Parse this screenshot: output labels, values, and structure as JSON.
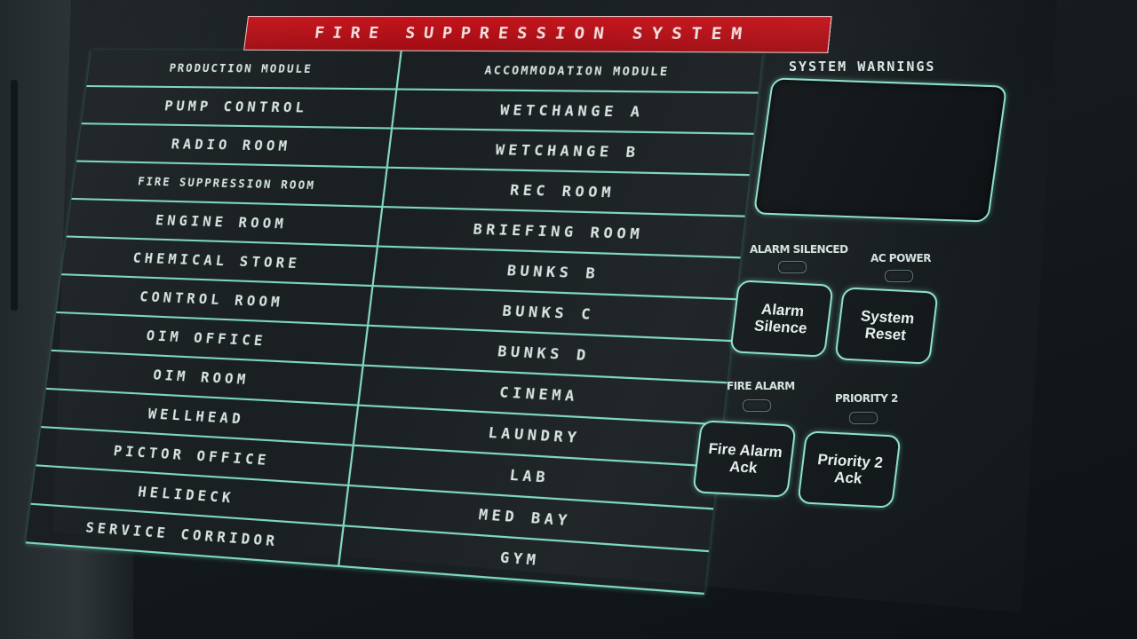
{
  "panel": {
    "title": "FIRE SUPPRESSION SYSTEM",
    "left_header": "PRODUCTION MODULE",
    "right_header": "ACCOMMODATION MODULE",
    "left_zones": [
      "PUMP CONTROL",
      "RADIO ROOM",
      "FIRE SUPPRESSION ROOM",
      "ENGINE ROOM",
      "CHEMICAL STORE",
      "CONTROL ROOM",
      "OIM OFFICE",
      "OIM ROOM",
      "WELLHEAD",
      "PICTOR OFFICE",
      "HELIDECK",
      "SERVICE CORRIDOR",
      ""
    ],
    "right_zones": [
      "WETCHANGE A",
      "WETCHANGE B",
      "REC ROOM",
      "BRIEFING ROOM",
      "BUNKS B",
      "BUNKS C",
      "BUNKS D",
      "CINEMA",
      "LAUNDRY",
      "LAB",
      "MED BAY",
      "GYM"
    ]
  },
  "warnings": {
    "title": "SYSTEM WARNINGS"
  },
  "indicators": {
    "alarm_silenced": "ALARM SILENCED",
    "ac_power": "AC POWER",
    "fire_alarm": "FIRE ALARM",
    "priority_2": "PRIORITY 2"
  },
  "buttons": {
    "alarm_silence": "Alarm\nSilence",
    "system_reset": "System\nReset",
    "fire_alarm_ack": "Fire Alarm\nAck",
    "priority_2_ack": "Priority 2\nAck"
  },
  "colors": {
    "title_red": "#c4141c",
    "line_glow": "#8ee0cb",
    "text": "#d7e6e2"
  }
}
